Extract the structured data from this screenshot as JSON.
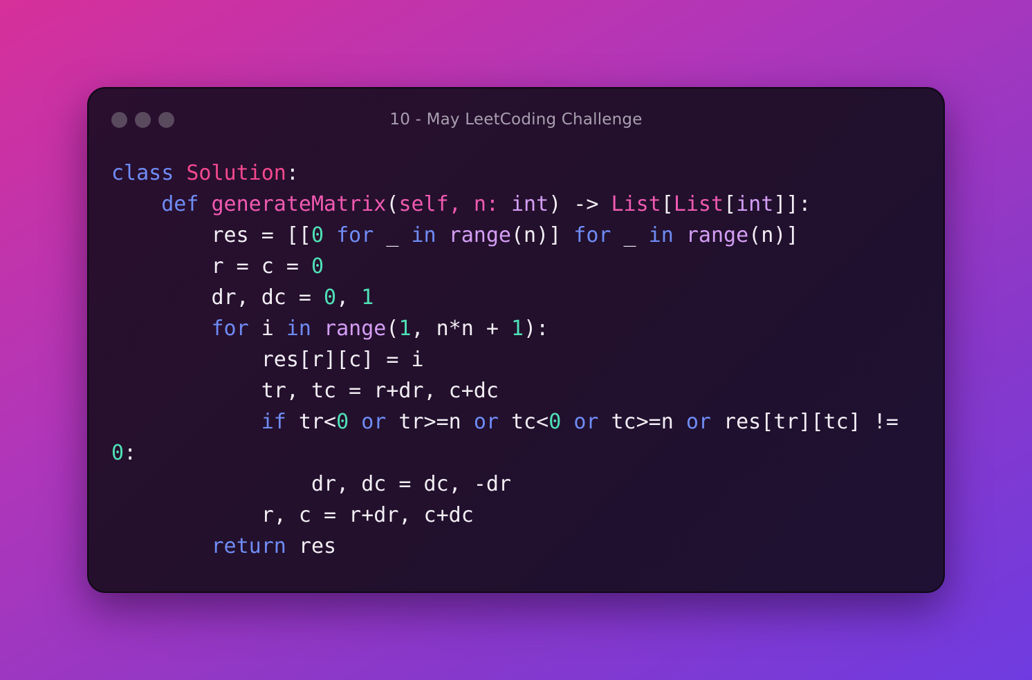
{
  "window": {
    "title": "10 - May LeetCoding Challenge",
    "buttons": [
      "close",
      "minimize",
      "maximize"
    ]
  },
  "code": {
    "language": "python",
    "lines": [
      [
        {
          "t": "class",
          "c": "kw"
        },
        {
          "t": " "
        },
        {
          "t": "Solution",
          "c": "cls"
        },
        {
          "t": ":"
        }
      ],
      [
        {
          "t": "    "
        },
        {
          "t": "def",
          "c": "kw"
        },
        {
          "t": " "
        },
        {
          "t": "generateMatrix",
          "c": "fn"
        },
        {
          "t": "("
        },
        {
          "t": "self",
          "c": "self"
        },
        {
          "t": ", ",
          "c": "self"
        },
        {
          "t": "n:",
          "c": "self"
        },
        {
          "t": " "
        },
        {
          "t": "int",
          "c": "bi"
        },
        {
          "t": ") -> "
        },
        {
          "t": "List",
          "c": "typ"
        },
        {
          "t": "["
        },
        {
          "t": "List",
          "c": "typ"
        },
        {
          "t": "["
        },
        {
          "t": "int",
          "c": "bi"
        },
        {
          "t": "]]:"
        }
      ],
      [
        {
          "t": "        res = [["
        },
        {
          "t": "0",
          "c": "num"
        },
        {
          "t": " "
        },
        {
          "t": "for",
          "c": "kw"
        },
        {
          "t": " _ "
        },
        {
          "t": "in",
          "c": "kw"
        },
        {
          "t": " "
        },
        {
          "t": "range",
          "c": "bi"
        },
        {
          "t": "(n)] "
        },
        {
          "t": "for",
          "c": "kw"
        },
        {
          "t": " _ "
        },
        {
          "t": "in",
          "c": "kw"
        },
        {
          "t": " "
        },
        {
          "t": "range",
          "c": "bi"
        },
        {
          "t": "(n)]"
        }
      ],
      [
        {
          "t": "        r = c = "
        },
        {
          "t": "0",
          "c": "num"
        }
      ],
      [
        {
          "t": "        dr, dc = "
        },
        {
          "t": "0",
          "c": "num"
        },
        {
          "t": ", "
        },
        {
          "t": "1",
          "c": "num"
        }
      ],
      [
        {
          "t": "        "
        },
        {
          "t": "for",
          "c": "kw"
        },
        {
          "t": " i "
        },
        {
          "t": "in",
          "c": "kw"
        },
        {
          "t": " "
        },
        {
          "t": "range",
          "c": "bi"
        },
        {
          "t": "("
        },
        {
          "t": "1",
          "c": "num"
        },
        {
          "t": ", n*n + "
        },
        {
          "t": "1",
          "c": "num"
        },
        {
          "t": "):"
        }
      ],
      [
        {
          "t": "            res[r][c] = i"
        }
      ],
      [
        {
          "t": "            tr, tc = r+dr, c+dc"
        }
      ],
      [
        {
          "t": "            "
        },
        {
          "t": "if",
          "c": "kw"
        },
        {
          "t": " tr<"
        },
        {
          "t": "0",
          "c": "num"
        },
        {
          "t": " "
        },
        {
          "t": "or",
          "c": "kw"
        },
        {
          "t": " tr>=n "
        },
        {
          "t": "or",
          "c": "kw"
        },
        {
          "t": " tc<"
        },
        {
          "t": "0",
          "c": "num"
        },
        {
          "t": " "
        },
        {
          "t": "or",
          "c": "kw"
        },
        {
          "t": " tc>=n "
        },
        {
          "t": "or",
          "c": "kw"
        },
        {
          "t": " res[tr][tc] !="
        }
      ],
      [
        {
          "t": "0",
          "c": "num"
        },
        {
          "t": ":"
        }
      ],
      [
        {
          "t": "                dr, dc = dc, -dr"
        }
      ],
      [
        {
          "t": "            r, c = r+dr, c+dc"
        }
      ],
      [
        {
          "t": "        "
        },
        {
          "t": "return",
          "c": "kw"
        },
        {
          "t": " res"
        }
      ]
    ]
  },
  "colors": {
    "keyword": "#6f8cf5",
    "class_name": "#f5498f",
    "function_name": "#f05ab0",
    "builtin": "#d49ef5",
    "number": "#4fe0b6",
    "text": "#f2eef4",
    "title": "#a99fb0",
    "window_bg": "#22102c"
  }
}
